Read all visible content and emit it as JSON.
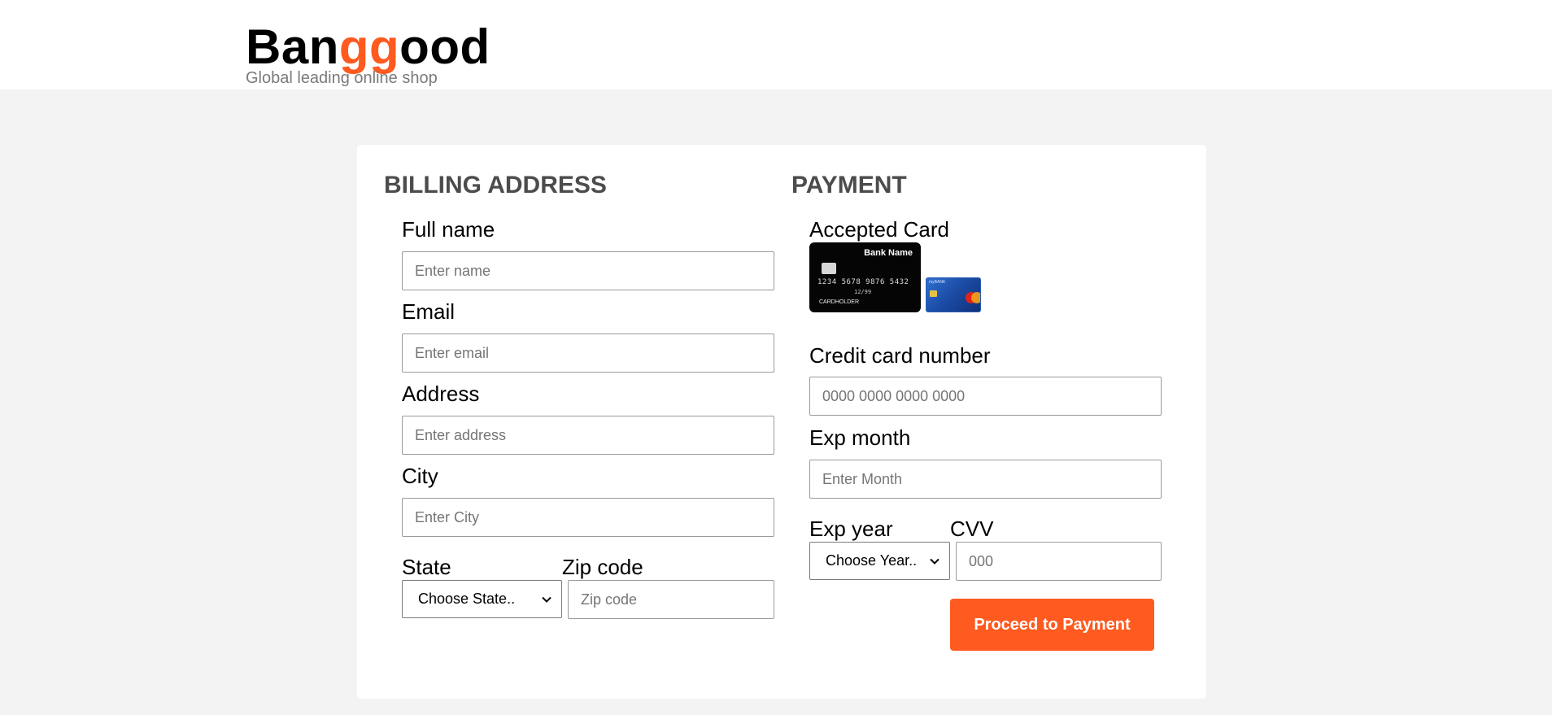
{
  "header": {
    "logo_prefix": "Ban",
    "logo_highlight": "gg",
    "logo_suffix": "ood",
    "tagline": "Global leading online shop"
  },
  "billing": {
    "title": "BILLING ADDRESS",
    "full_name_label": "Full name",
    "full_name_placeholder": "Enter name",
    "email_label": "Email",
    "email_placeholder": "Enter email",
    "address_label": "Address",
    "address_placeholder": "Enter address",
    "city_label": "City",
    "city_placeholder": "Enter City",
    "state_label": "State",
    "state_selected": "Choose State..",
    "zip_label": "Zip code",
    "zip_placeholder": "Zip code"
  },
  "payment": {
    "title": "PAYMENT",
    "accepted_label": "Accepted Card",
    "card_black": {
      "bank_name": "Bank Name",
      "number": "1234 5678 9876 5432",
      "expiry": "12/99",
      "holder": "CARDHOLDER"
    },
    "card_blue": {
      "bank_name": "myBANK"
    },
    "cc_number_label": "Credit card number",
    "cc_number_placeholder": "0000 0000 0000 0000",
    "exp_month_label": "Exp month",
    "exp_month_placeholder": "Enter Month",
    "exp_year_label": "Exp year",
    "exp_year_selected": "Choose Year..",
    "cvv_label": "CVV",
    "cvv_placeholder": "000",
    "proceed_label": "Proceed to Payment"
  },
  "colors": {
    "brand_orange": "#ff5a1f",
    "page_bg": "#f3f3f3",
    "card_bg": "#ffffff",
    "title_gray": "#4c4c4c"
  }
}
